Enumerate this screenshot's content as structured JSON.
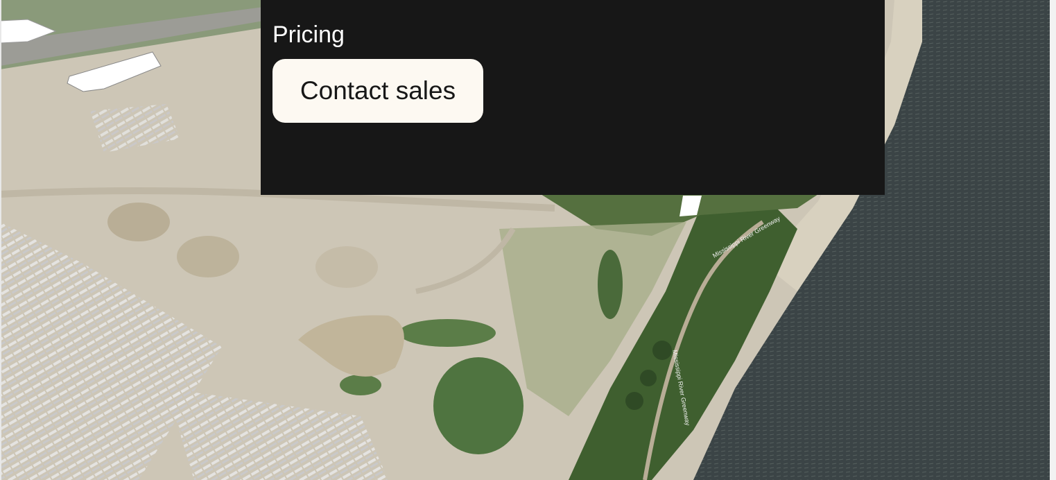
{
  "menu": {
    "pricing_label": "Pricing",
    "contact_label": "Contact sales"
  },
  "map": {
    "road_label_1": "Mississippi River Greenway",
    "road_label_2": "Mississippi River Greenway"
  },
  "colors": {
    "overlay_bg": "#171717",
    "button_bg": "#fdf9f2",
    "text_light": "#ffffff",
    "text_dark": "#171717",
    "river": "#3a4346",
    "ground": "#cfc8b8",
    "vegetation": "#4b6b3a"
  }
}
